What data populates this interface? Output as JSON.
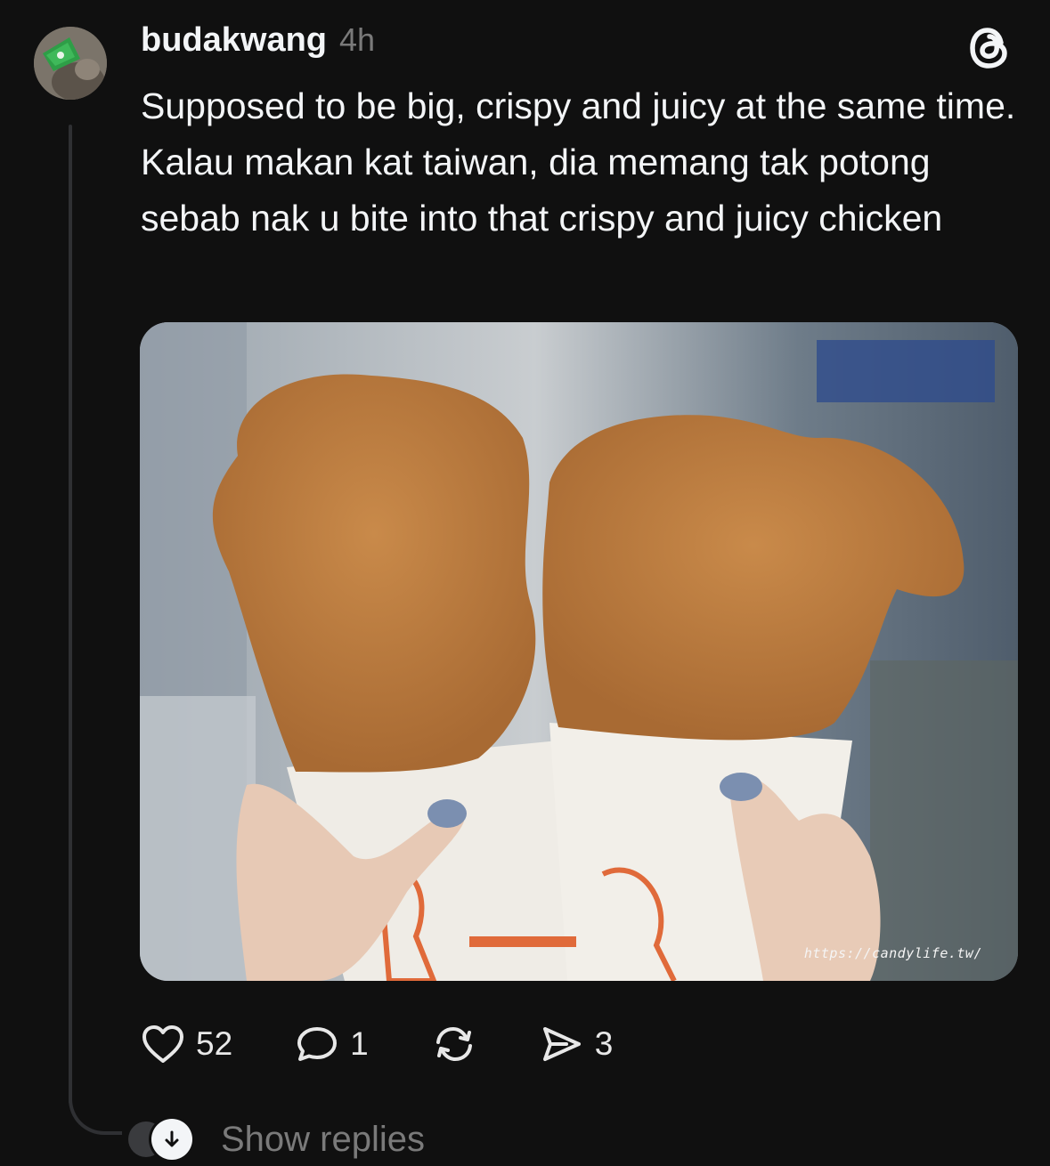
{
  "post": {
    "username": "budakwang",
    "time": "4h",
    "text": "Supposed to be big, crispy and juicy at the same time. Kalau makan kat taiwan, dia memang tak potong sebab nak u bite into that crispy and juicy chicken",
    "image": {
      "description": "two hands holding large fried chicken cutlets in paper bags",
      "watermark": "https://candylife.tw/"
    }
  },
  "actions": {
    "likes": "52",
    "comments": "1",
    "shares": "3"
  },
  "replies": {
    "label": "Show replies"
  },
  "icons": [
    "threads-logo-icon",
    "heart-icon",
    "comment-icon",
    "repost-icon",
    "share-icon",
    "arrow-down-icon"
  ]
}
